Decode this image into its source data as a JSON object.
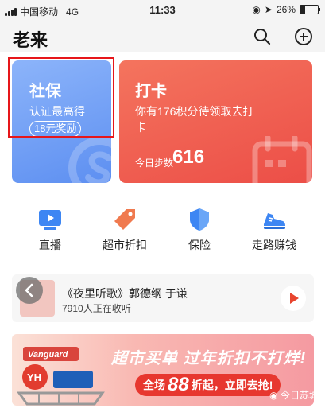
{
  "status_bar": {
    "carrier": "中国移动",
    "network": "4G",
    "time": "11:33",
    "battery": "26%",
    "battery_level": 0.26
  },
  "header": {
    "title": "老来"
  },
  "cards": {
    "shebao": {
      "title": "社保",
      "subtitle": "认证最高得",
      "badge": "18元奖励"
    },
    "daka": {
      "title": "打卡",
      "subtitle": "你有176积分待领取去打卡",
      "steps_label": "今日步数",
      "steps_value": "616"
    }
  },
  "quick_actions": [
    {
      "label": "直播",
      "icon": "tv-play-icon"
    },
    {
      "label": "超市折扣",
      "icon": "price-tag-icon"
    },
    {
      "label": "保险",
      "icon": "shield-icon"
    },
    {
      "label": "走路赚钱",
      "icon": "sneaker-icon"
    }
  ],
  "audio": {
    "title": "《夜里听歌》郭德纲 于谦",
    "listeners": "7910人正在收听"
  },
  "banner": {
    "headline": "超市买单 过年折扣不打烊!",
    "pill_prefix": "全场",
    "pill_number": "88",
    "pill_suffix": "折起，立即去抢!",
    "watermark": "今日苏城",
    "logo_text": "Vanguard"
  },
  "colors": {
    "blue_card": "#5d8ff1",
    "red_card": "#ec4e47",
    "accent_red": "#e6161a"
  }
}
